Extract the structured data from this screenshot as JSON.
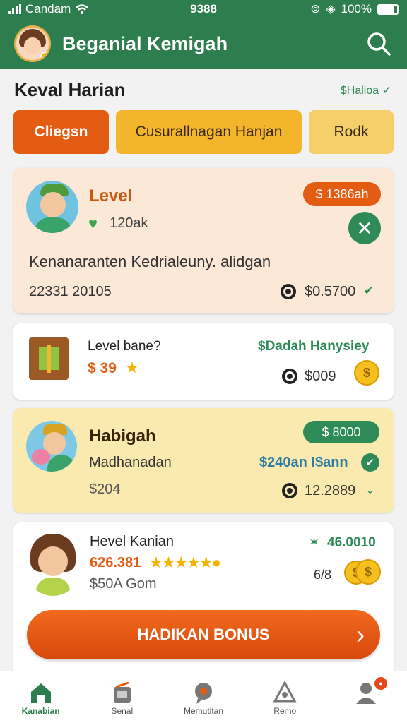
{
  "status_bar": {
    "carrier": "Candam",
    "time": "9388",
    "battery": "100%"
  },
  "header": {
    "title": "Beganial Kemigah"
  },
  "section": {
    "title": "Keval Harian",
    "link": "$Halioa ✓"
  },
  "tabs": [
    "Cliegsn",
    "Cusurallnagan Hanjan",
    "Rodk"
  ],
  "cards": [
    {
      "title": "Level",
      "price_pill": "$ 1386ah",
      "likes": "120ak",
      "description": "Kenanaranten Kedrialeuny. alidgan",
      "meta": "22331 20105",
      "amount": "$0.5700",
      "colors": {
        "accent": "#e35c12"
      }
    },
    {
      "title": "Level bane?",
      "price": "$ 39",
      "header_right": "$Dadah Hanysiey",
      "amount": "$009"
    },
    {
      "title": "Habigah",
      "subtitle": "Madhanadan",
      "price": "$204",
      "pill": "$ 8000",
      "highlight": "$240an I$ann",
      "amount": "12.2889"
    },
    {
      "title": "Hevel Kanian",
      "score": "626.381",
      "subtitle": "$50A Gom",
      "right_value": "46.0010",
      "count": "6/8"
    }
  ],
  "cta": {
    "label": "HADIKAN BONUS"
  },
  "nav": [
    {
      "label": "Kanabian",
      "icon": "home-icon"
    },
    {
      "label": "Senal",
      "icon": "store-icon"
    },
    {
      "label": "Memutitan",
      "icon": "chat-icon"
    },
    {
      "label": "Remo",
      "icon": "bell-icon"
    },
    {
      "label": "",
      "icon": "profile-icon"
    }
  ],
  "theme": {
    "primary": "#2e7d4f",
    "accent": "#e35c12",
    "gold": "#f2b52c"
  }
}
